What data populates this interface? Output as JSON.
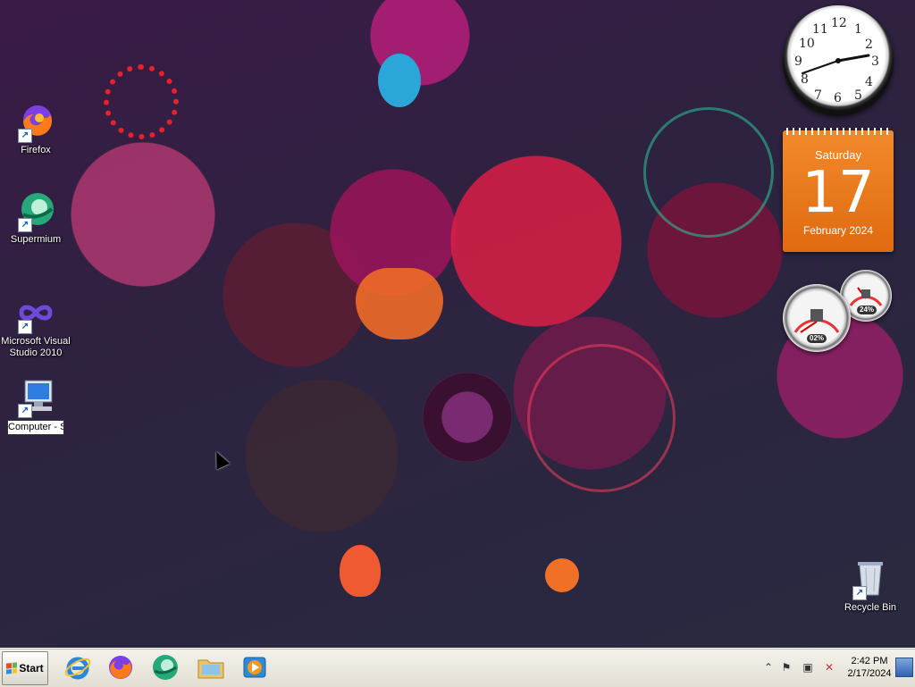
{
  "desktop": {
    "icons": [
      {
        "label": "Firefox",
        "icon": "firefox-icon"
      },
      {
        "label": "Supermium",
        "icon": "supermium-icon"
      },
      {
        "label": "Microsoft Visual Studio 2010",
        "icon": "visual-studio-icon"
      },
      {
        "label": "Computer - Shortc",
        "icon": "computer-icon",
        "editing": true
      },
      {
        "label": "Recycle Bin",
        "icon": "recycle-bin-icon"
      }
    ]
  },
  "gadgets": {
    "clock": {
      "numbers": [
        "12",
        "1",
        "2",
        "3",
        "4",
        "5",
        "6",
        "7",
        "8",
        "9",
        "10",
        "11"
      ],
      "time_shown": "2:42"
    },
    "calendar": {
      "day_name": "Saturday",
      "day_number": "17",
      "month_year": "February 2024"
    },
    "cpu_meter": {
      "cpu_value": "02%",
      "memory_value": "24%"
    }
  },
  "taskbar": {
    "start_label": "Start",
    "pinned": [
      {
        "name": "internet-explorer",
        "icon": "internet-explorer-icon"
      },
      {
        "name": "firefox",
        "icon": "firefox-icon"
      },
      {
        "name": "supermium",
        "icon": "supermium-icon"
      },
      {
        "name": "file-explorer",
        "icon": "folder-icon"
      },
      {
        "name": "media-player",
        "icon": "media-player-icon"
      }
    ],
    "tray": {
      "time": "2:42 PM",
      "date": "2/17/2024"
    }
  },
  "colors": {
    "calendar_orange": "#e97a1e",
    "taskbar": "#ece9e0",
    "desktop_base": "#2d2340"
  }
}
